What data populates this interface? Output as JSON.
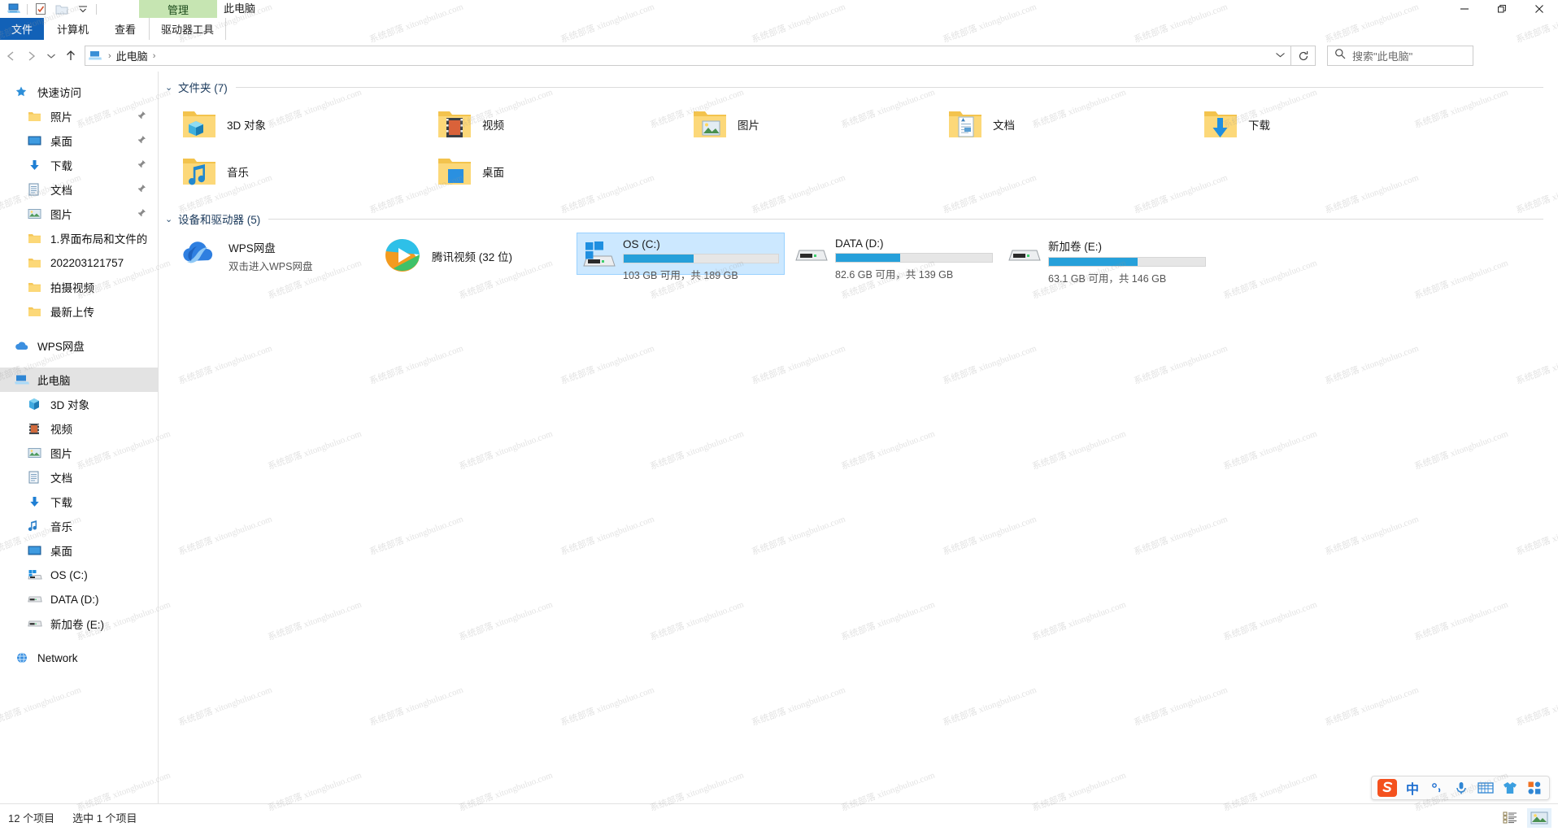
{
  "window": {
    "title": "此电脑",
    "contextual_tab_group": "管理",
    "quick_access": [
      {
        "name": "this-pc-icon",
        "label": "此电脑"
      },
      {
        "name": "properties-icon",
        "label": "属性"
      },
      {
        "name": "new-folder-icon",
        "label": "新建文件夹"
      },
      {
        "name": "customize-qat-dropdown",
        "label": "自定义快速访问工具栏"
      }
    ],
    "controls": [
      {
        "name": "minimize-button",
        "glyph": "—"
      },
      {
        "name": "restore-button",
        "glyph": "❐"
      },
      {
        "name": "close-button",
        "glyph": "✕"
      }
    ],
    "ribbon_collapse": "⌄",
    "help_label": "?"
  },
  "ribbon": {
    "tabs": [
      {
        "label": "文件",
        "active": true,
        "kind": "file"
      },
      {
        "label": "计算机",
        "active": false,
        "kind": "normal"
      },
      {
        "label": "查看",
        "active": false,
        "kind": "normal"
      },
      {
        "label": "驱动器工具",
        "active": true,
        "kind": "contextual"
      }
    ]
  },
  "navigation": {
    "back_label": "后退",
    "forward_label": "前进",
    "recent_label": "最近浏览的位置",
    "up_label": "上移一级",
    "refresh_label": "刷新",
    "breadcrumb": [
      "此电脑"
    ],
    "breadcrumb_separator": "›",
    "dropdown": "⌄"
  },
  "search": {
    "placeholder": "搜索\"此电脑\"",
    "icon": "search-icon"
  },
  "sidebar": {
    "items": [
      {
        "label": "快速访问",
        "icon": "star-pin-icon",
        "level": "root",
        "pinned": false,
        "selected": false
      },
      {
        "label": "照片",
        "icon": "folder-icon",
        "level": "child",
        "pinned": true,
        "selected": false
      },
      {
        "label": "桌面",
        "icon": "desktop-icon",
        "level": "child",
        "pinned": true,
        "selected": false
      },
      {
        "label": "下载",
        "icon": "download-icon",
        "level": "child",
        "pinned": true,
        "selected": false
      },
      {
        "label": "文档",
        "icon": "document-icon",
        "level": "child",
        "pinned": true,
        "selected": false
      },
      {
        "label": "图片",
        "icon": "pictures-icon",
        "level": "child",
        "pinned": true,
        "selected": false
      },
      {
        "label": "1.界面布局和文件的",
        "icon": "folder-icon",
        "level": "child",
        "pinned": false,
        "selected": false
      },
      {
        "label": "202203121757",
        "icon": "folder-icon",
        "level": "child",
        "pinned": false,
        "selected": false
      },
      {
        "label": "拍摄视频",
        "icon": "folder-icon",
        "level": "child",
        "pinned": false,
        "selected": false
      },
      {
        "label": "最新上传",
        "icon": "folder-icon",
        "level": "child",
        "pinned": false,
        "selected": false
      },
      {
        "label": "WPS网盘",
        "icon": "cloud-icon",
        "level": "root",
        "pinned": false,
        "selected": false,
        "gap_before": true
      },
      {
        "label": "此电脑",
        "icon": "this-pc-icon",
        "level": "root",
        "pinned": false,
        "selected": true,
        "gap_before": true
      },
      {
        "label": "3D 对象",
        "icon": "3d-object-icon",
        "level": "child",
        "pinned": false,
        "selected": false
      },
      {
        "label": "视频",
        "icon": "videos-icon",
        "level": "child",
        "pinned": false,
        "selected": false
      },
      {
        "label": "图片",
        "icon": "pictures-icon",
        "level": "child",
        "pinned": false,
        "selected": false
      },
      {
        "label": "文档",
        "icon": "document-icon",
        "level": "child",
        "pinned": false,
        "selected": false
      },
      {
        "label": "下载",
        "icon": "download-icon",
        "level": "child",
        "pinned": false,
        "selected": false
      },
      {
        "label": "音乐",
        "icon": "music-icon",
        "level": "child",
        "pinned": false,
        "selected": false
      },
      {
        "label": "桌面",
        "icon": "desktop-icon",
        "level": "child",
        "pinned": false,
        "selected": false
      },
      {
        "label": "OS (C:)",
        "icon": "windows-drive-icon",
        "level": "child",
        "pinned": false,
        "selected": false
      },
      {
        "label": "DATA (D:)",
        "icon": "drive-icon",
        "level": "child",
        "pinned": false,
        "selected": false
      },
      {
        "label": "新加卷 (E:)",
        "icon": "drive-icon",
        "level": "child",
        "pinned": false,
        "selected": false
      },
      {
        "label": "Network",
        "icon": "network-icon",
        "level": "root",
        "pinned": false,
        "selected": false,
        "gap_before": true
      }
    ]
  },
  "main": {
    "groups": [
      {
        "title": "文件夹 (7)",
        "chevron": "⌄"
      },
      {
        "title": "设备和驱动器 (5)",
        "chevron": "⌄"
      }
    ],
    "folders": [
      {
        "label": "3D 对象",
        "icon": "folder-3d-object-icon"
      },
      {
        "label": "视频",
        "icon": "folder-videos-icon"
      },
      {
        "label": "图片",
        "icon": "folder-pictures-icon"
      },
      {
        "label": "文档",
        "icon": "folder-documents-icon"
      },
      {
        "label": "下载",
        "icon": "folder-downloads-icon"
      },
      {
        "label": "音乐",
        "icon": "folder-music-icon"
      },
      {
        "label": "桌面",
        "icon": "folder-desktop-icon"
      }
    ],
    "network_apps": [
      {
        "name": "WPS网盘",
        "subtitle": "双击进入WPS网盘",
        "icon": "wps-cloud-icon"
      },
      {
        "name": "腾讯视频 (32 位)",
        "subtitle": "",
        "icon": "tencent-video-icon"
      }
    ],
    "drives": [
      {
        "label": "OS (C:)",
        "free_text": "103 GB 可用，共 189 GB",
        "free_gb": 103,
        "total_gb": 189,
        "used_percent": 45,
        "icon": "windows-drive-icon",
        "selected": true
      },
      {
        "label": "DATA (D:)",
        "free_text": "82.6 GB 可用，共 139 GB",
        "free_gb": 82.6,
        "total_gb": 139,
        "used_percent": 41,
        "icon": "drive-icon",
        "selected": false
      },
      {
        "label": "新加卷 (E:)",
        "free_text": "63.1 GB 可用，共 146 GB",
        "free_gb": 63.1,
        "total_gb": 146,
        "used_percent": 57,
        "icon": "drive-icon",
        "selected": false
      }
    ]
  },
  "statusbar": {
    "item_count": "12 个项目",
    "selection": "选中 1 个项目",
    "views": [
      {
        "name": "details-view-button",
        "label": "详细信息",
        "active": false
      },
      {
        "name": "large-icons-view-button",
        "label": "大图标",
        "active": true
      }
    ]
  },
  "ime": {
    "logo_label": "S",
    "items": [
      {
        "name": "ime-language-mode",
        "label": "中"
      },
      {
        "name": "ime-punctuation-mode",
        "label": "°,"
      },
      {
        "name": "ime-voice-input",
        "label": "语音"
      },
      {
        "name": "ime-soft-keyboard",
        "label": "软键盘"
      },
      {
        "name": "ime-skin-center",
        "label": "皮肤"
      },
      {
        "name": "ime-toolbox",
        "label": "工具箱"
      }
    ]
  },
  "watermark": "系统部落 xitongbuluo.com",
  "colors": {
    "accent": "#1261b7",
    "selection": "#cce8ff",
    "bar_fill": "#26a0da",
    "contextual_tab": "#c6e5b2",
    "group_title": "#1b3a5c"
  }
}
